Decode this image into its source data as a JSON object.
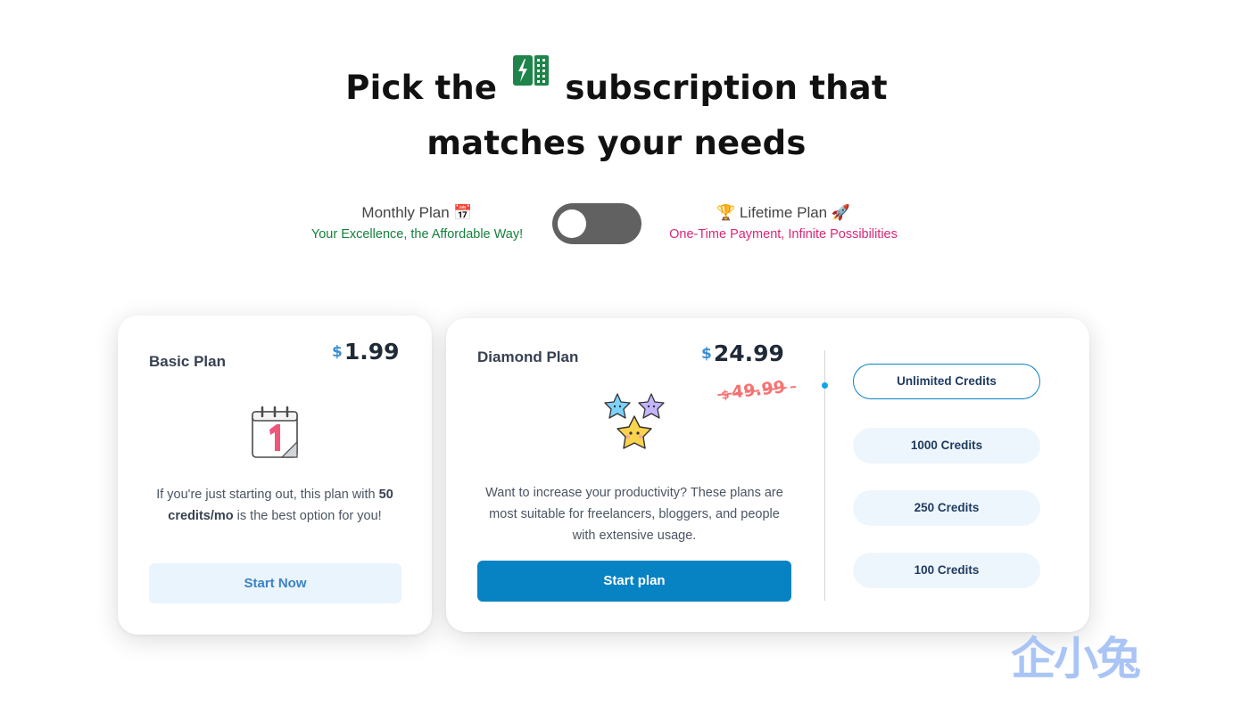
{
  "heading": {
    "line1_before": "Pick the",
    "line1_after": "subscription that",
    "line2": "matches your needs",
    "logo_icon": "spreadsheet-lightning-icon"
  },
  "billing_toggle": {
    "monthly_label": "Monthly Plan 📅",
    "monthly_tagline": "Your Excellence, the Affordable Way!",
    "lifetime_label": "🏆 Lifetime Plan 🚀",
    "lifetime_tagline": "One-Time Payment, Infinite Possibilities",
    "state": "monthly"
  },
  "plans": {
    "basic": {
      "title": "Basic Plan",
      "currency": "$",
      "price": "1.99",
      "icon": "calendar-day-1-icon",
      "desc_before": "If you're just starting out, this plan with",
      "desc_bold": "50 credits/mo",
      "desc_after": "is the best option for you!",
      "button": "Start Now"
    },
    "diamond": {
      "title": "Diamond Plan",
      "currency": "$",
      "price": "24.99",
      "old_currency": "$",
      "old_price": "49.99",
      "icon": "three-stars-icon",
      "description": "Want to increase your productivity? These plans are most suitable for freelancers, bloggers, and people with extensive usage.",
      "button": "Start plan",
      "credit_options": [
        "Unlimited Credits",
        "1000 Credits",
        "250 Credits",
        "100 Credits"
      ],
      "selected_credit": "Unlimited Credits"
    }
  },
  "watermark": "企小兔",
  "colors": {
    "primary": "#0783c4",
    "monthly_tagline": "#15803d",
    "lifetime_tagline": "#db2777",
    "old_price": "#f87171",
    "toggle_track": "#616161"
  }
}
